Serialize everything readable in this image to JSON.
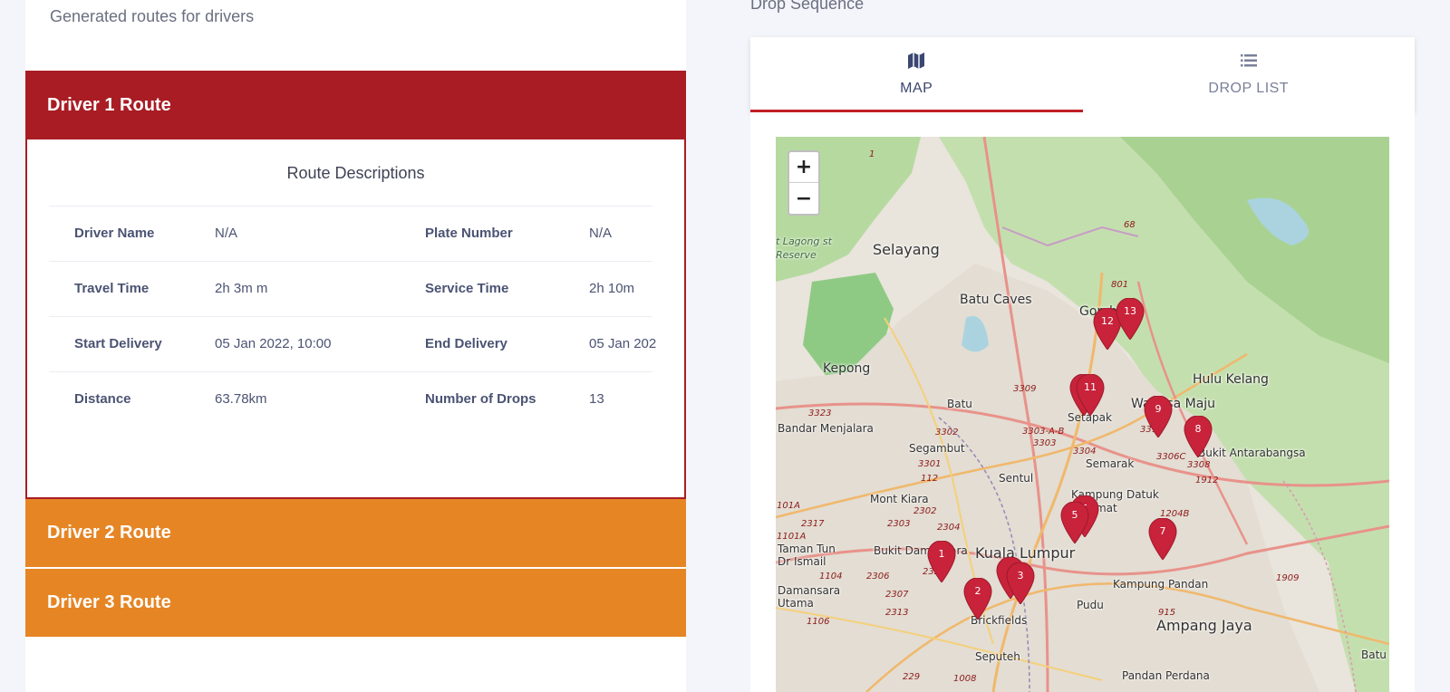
{
  "left": {
    "subtitle": "Generated routes for drivers",
    "routes": [
      {
        "label": "Driver 1 Route",
        "color": "#a91c24"
      },
      {
        "label": "Driver 2 Route",
        "color": "#e68524"
      },
      {
        "label": "Driver 3 Route",
        "color": "#e68524"
      }
    ],
    "description": {
      "title": "Route Descriptions",
      "rows": [
        {
          "k1": "Driver Name",
          "v1": "N/A",
          "k2": "Plate Number",
          "v2": "N/A"
        },
        {
          "k1": "Travel Time",
          "v1": "2h 3m m",
          "k2": "Service Time",
          "v2": "2h 10m"
        },
        {
          "k1": "Start Delivery",
          "v1": "05 Jan 2022, 10:00",
          "k2": "End Delivery",
          "v2": "05 Jan 202"
        },
        {
          "k1": "Distance",
          "v1": "63.78km",
          "k2": "Number of Drops",
          "v2": "13"
        }
      ]
    }
  },
  "right": {
    "section_title": "Drop Sequence",
    "tabs": [
      {
        "label": "MAP",
        "icon": "map-icon",
        "active": true
      },
      {
        "label": "DROP LIST",
        "icon": "list-icon",
        "active": false
      }
    ],
    "map": {
      "zoom_in": "+",
      "zoom_out": "−",
      "places": [
        "Selayang",
        "Batu Caves",
        "Gombak",
        "Kepong",
        "Hulu Kelang",
        "Batu",
        "Setapak",
        "Wangsa Maju",
        "Bandar Menjalara",
        "Segambut",
        "Semarak",
        "Bukit Antarabangsa",
        "Sentul",
        "Mont Kiara",
        "Kampung Datuk Keramat",
        "Taman Tun Dr Ismail",
        "Bukit Damansara",
        "Kuala Lumpur",
        "Kampung Pandan",
        "Damansara Utama",
        "Brickfields",
        "Pudu",
        "Ampang Jaya",
        "Seputeh",
        "Pandan Perdana",
        "Batu La",
        "t Lagong st Reserve"
      ],
      "road_numbers": [
        "1",
        "68",
        "801",
        "3309",
        "3323",
        "3302",
        "3303-A-B",
        "3303",
        "3304",
        "3306C",
        "3308",
        "1912",
        "3301",
        "112",
        "101A",
        "2317",
        "2303",
        "2302",
        "2304",
        "1204B",
        "1101A",
        "1104",
        "2306",
        "2307",
        "2313",
        "1106",
        "915",
        "1909",
        "229",
        "1008",
        "3312",
        "232"
      ],
      "markers": [
        "1",
        "2",
        "3",
        "5",
        "5",
        "7",
        "8",
        "9",
        "11",
        "12",
        "13"
      ],
      "marker_color": "#c8233a"
    }
  }
}
